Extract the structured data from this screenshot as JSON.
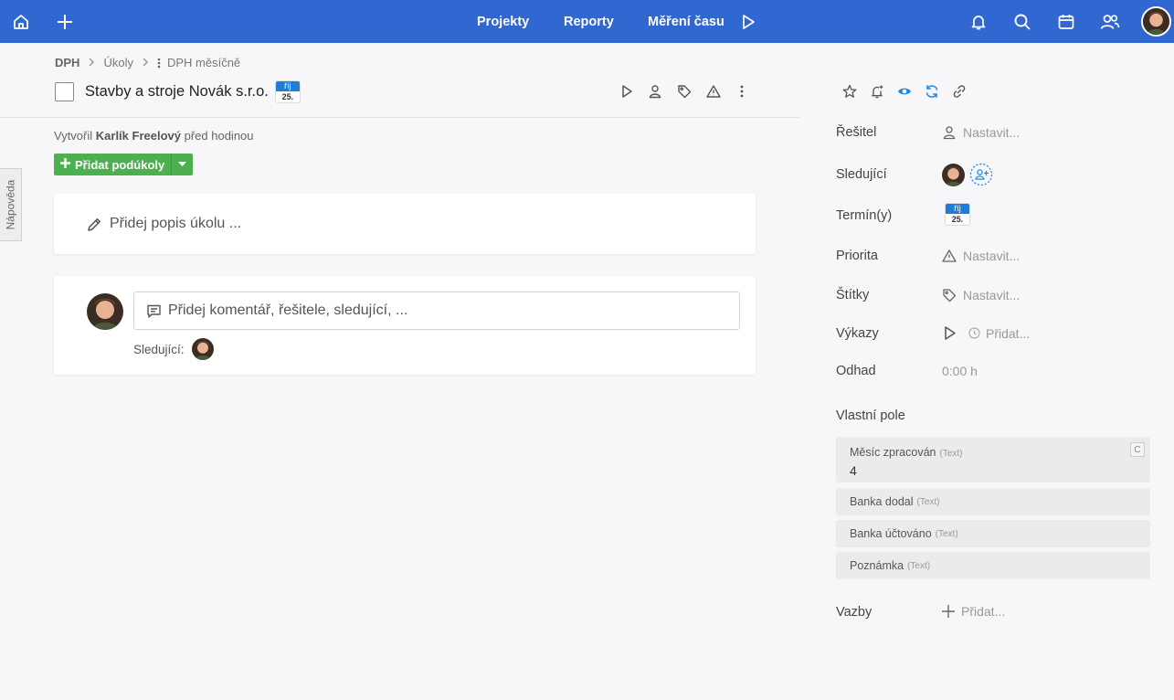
{
  "topbar": {
    "nav": {
      "projects": "Projekty",
      "reports": "Reporty",
      "time_tracking": "Měření času"
    },
    "icons": [
      "home-icon",
      "plus-icon",
      "play-icon",
      "bell-icon",
      "search-icon",
      "calendar-icon",
      "users-icon"
    ],
    "color": "#3167d0"
  },
  "help_tab": {
    "label": "Nápověda"
  },
  "breadcrumb": {
    "items": [
      "DPH",
      "Úkoly",
      "DPH měsíčně"
    ]
  },
  "task": {
    "title": "Stavby a stroje Novák s.r.o.",
    "due": {
      "month": "říj",
      "day": "25."
    },
    "created_prefix": "Vytvořil",
    "created_by": "Karlík Freelový",
    "created_suffix": "před hodinou",
    "add_subtasks_label": "Přidat podúkoly",
    "description_placeholder": "Přidej popis úkolu ...",
    "comment_placeholder": "Přidej komentář, řešitele, sledující, ...",
    "followers_label": "Sledující:"
  },
  "props": {
    "assignee": {
      "label": "Řešitel",
      "value": "Nastavit..."
    },
    "followers": {
      "label": "Sledující"
    },
    "deadline": {
      "label": "Termín(y)",
      "month": "říj",
      "day": "25."
    },
    "priority": {
      "label": "Priorita",
      "value": "Nastavit..."
    },
    "tags": {
      "label": "Štítky",
      "value": "Nastavit..."
    },
    "timesheets": {
      "label": "Výkazy",
      "value": "Přidat..."
    },
    "estimate": {
      "label": "Odhad",
      "value": "0:00 h"
    },
    "custom_fields_title": "Vlastní pole",
    "custom_fields": [
      {
        "name": "Měsíc zpracován",
        "type": "(Text)",
        "value": "4",
        "badge": "C"
      },
      {
        "name": "Banka dodal",
        "type": "(Text)"
      },
      {
        "name": "Banka účtováno",
        "type": "(Text)"
      },
      {
        "name": "Poznámka",
        "type": "(Text)"
      }
    ],
    "links": {
      "label": "Vazby",
      "value": "Přidat..."
    }
  },
  "colors": {
    "accent_green": "#4caf50",
    "badge_blue": "#1e7dd6",
    "watch_blue": "#1e88e5"
  }
}
